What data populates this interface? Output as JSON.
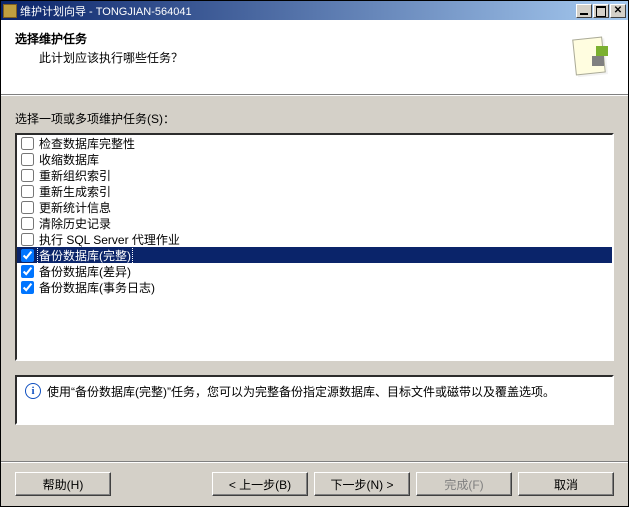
{
  "window": {
    "title": "维护计划向导 - TONGJIAN-564041"
  },
  "header": {
    "title": "选择维护任务",
    "subtitle": "此计划应该执行哪些任务？"
  },
  "listLabel": "选择一项或多项维护任务(S)：",
  "tasks": [
    {
      "label": "检查数据库完整性",
      "checked": false,
      "selected": false
    },
    {
      "label": "收缩数据库",
      "checked": false,
      "selected": false
    },
    {
      "label": "重新组织索引",
      "checked": false,
      "selected": false
    },
    {
      "label": "重新生成索引",
      "checked": false,
      "selected": false
    },
    {
      "label": "更新统计信息",
      "checked": false,
      "selected": false
    },
    {
      "label": "清除历史记录",
      "checked": false,
      "selected": false
    },
    {
      "label": "执行 SQL Server 代理作业",
      "checked": false,
      "selected": false
    },
    {
      "label": "备份数据库(完整)",
      "checked": true,
      "selected": true
    },
    {
      "label": "备份数据库(差异)",
      "checked": true,
      "selected": false
    },
    {
      "label": "备份数据库(事务日志)",
      "checked": true,
      "selected": false
    }
  ],
  "description": "使用“备份数据库(完整)”任务，您可以为完整备份指定源数据库、目标文件或磁带以及覆盖选项。",
  "buttons": {
    "help": "帮助(H)",
    "back": "< 上一步(B)",
    "next": "下一步(N) >",
    "finish": "完成(F)",
    "cancel": "取消"
  }
}
